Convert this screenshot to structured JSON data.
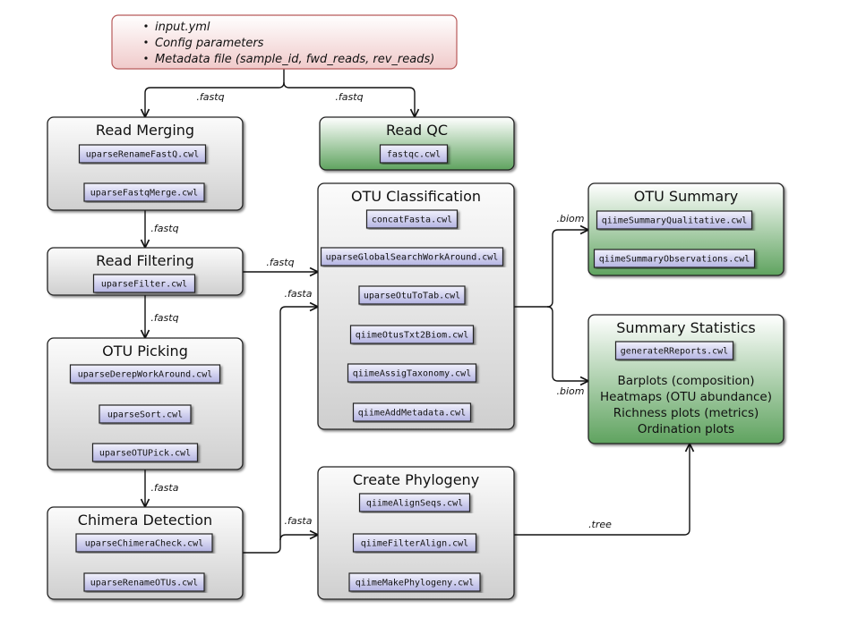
{
  "colors": {
    "input_fill": "#f6dcdc",
    "input_border": "#b85a5a",
    "grey_fill": "#dcdcdc",
    "green_fill": "#6aab6a",
    "script_fill": "#c8c8ea",
    "border": "#222222"
  },
  "input": {
    "items": [
      "input.yml",
      "Config parameters",
      "Metadata file (sample_id, fwd_reads, rev_reads)"
    ]
  },
  "boxes": {
    "read_merging": {
      "title": "Read Merging",
      "scripts": [
        "uparseRenameFastQ.cwl",
        "uparseFastqMerge.cwl"
      ]
    },
    "read_qc": {
      "title": "Read QC",
      "scripts": [
        "fastqc.cwl"
      ]
    },
    "read_filtering": {
      "title": "Read Filtering",
      "scripts": [
        "uparseFilter.cwl"
      ]
    },
    "otu_picking": {
      "title": "OTU Picking",
      "scripts": [
        "uparseDerepWorkAround.cwl",
        "uparseSort.cwl",
        "uparseOTUPick.cwl"
      ]
    },
    "chimera_detection": {
      "title": "Chimera Detection",
      "scripts": [
        "uparseChimeraCheck.cwl",
        "uparseRenameOTUs.cwl"
      ]
    },
    "otu_classification": {
      "title": "OTU Classification",
      "scripts": [
        "concatFasta.cwl",
        "uparseGlobalSearchWorkAround.cwl",
        "uparseOtuToTab.cwl",
        "qiimeOtusTxt2Biom.cwl",
        "qiimeAssigTaxonomy.cwl",
        "qiimeAddMetadata.cwl"
      ]
    },
    "otu_summary": {
      "title": "OTU Summary",
      "scripts": [
        "qiimeSummaryQualitative.cwl",
        "qiimeSummaryObservations.cwl"
      ]
    },
    "summary_statistics": {
      "title": "Summary Statistics",
      "scripts": [
        "generateRReports.cwl"
      ],
      "outputs": [
        "Barplots (composition)",
        "Heatmaps (OTU abundance)",
        "Richness plots (metrics)",
        "Ordination plots"
      ]
    },
    "create_phylogeny": {
      "title": "Create Phylogeny",
      "scripts": [
        "qiimeAlignSeqs.cwl",
        "qiimeFilterAlign.cwl",
        "qiimeMakePhylogeny.cwl"
      ]
    }
  },
  "edge_labels": {
    "input_to_merging": ".fastq",
    "input_to_qc": ".fastq",
    "merging_to_filtering": ".fastq",
    "filtering_to_picking": ".fastq",
    "picking_to_chimera": ".fasta",
    "filtering_to_classification": ".fastq",
    "chimera_to_classification": ".fasta",
    "chimera_to_phylogeny": ".fasta",
    "classification_to_summary": ".biom",
    "classification_to_stats": ".biom",
    "phylogeny_to_stats": ".tree"
  }
}
